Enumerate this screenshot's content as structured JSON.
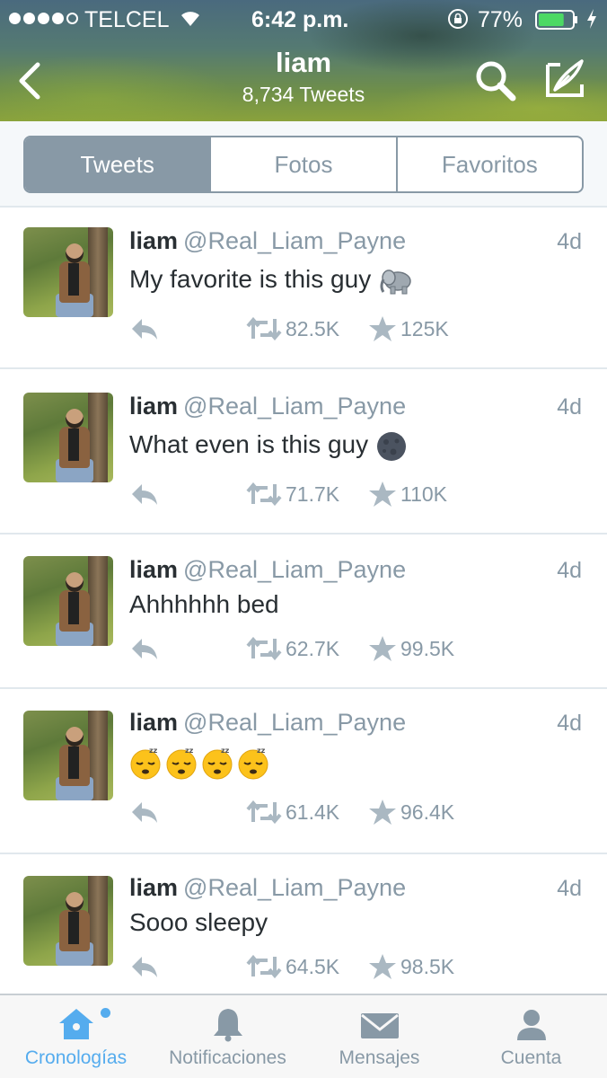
{
  "status_bar": {
    "carrier": "TELCEL",
    "time": "6:42 p.m.",
    "battery_percent": "77%",
    "battery_level": 0.77
  },
  "profile_header": {
    "title": "liam",
    "subtitle": "8,734 Tweets"
  },
  "segments": [
    "Tweets",
    "Fotos",
    "Favoritos"
  ],
  "active_segment": "Tweets",
  "tweets": [
    {
      "name": "liam",
      "handle": "@Real_Liam_Payne",
      "time": "4d",
      "text": "My favorite is this guy",
      "emoji": "elephant-emoji",
      "retweets": "82.5K",
      "favorites": "125K"
    },
    {
      "name": "liam",
      "handle": "@Real_Liam_Payne",
      "time": "4d",
      "text": "What even is this guy",
      "emoji": "new-moon-face-emoji",
      "retweets": "71.7K",
      "favorites": "110K"
    },
    {
      "name": "liam",
      "handle": "@Real_Liam_Payne",
      "time": "4d",
      "text": "Ahhhhhh bed",
      "emoji": "",
      "retweets": "62.7K",
      "favorites": "99.5K"
    },
    {
      "name": "liam",
      "handle": "@Real_Liam_Payne",
      "time": "4d",
      "text": "",
      "emoji": "sleeping-face-emoji x4",
      "retweets": "61.4K",
      "favorites": "96.4K"
    },
    {
      "name": "liam",
      "handle": "@Real_Liam_Payne",
      "time": "4d",
      "text": "Sooo sleepy",
      "emoji": "",
      "retweets": "64.5K",
      "favorites": "98.5K"
    }
  ],
  "tab_bar": {
    "items": [
      {
        "label": "Cronologías",
        "icon": "home-icon"
      },
      {
        "label": "Notificaciones",
        "icon": "bell-icon"
      },
      {
        "label": "Mensajes",
        "icon": "envelope-icon"
      },
      {
        "label": "Cuenta",
        "icon": "person-icon"
      }
    ],
    "active": "Cronologías"
  },
  "colors": {
    "accent": "#55acee",
    "muted": "#8899a6",
    "text": "#292f33"
  }
}
